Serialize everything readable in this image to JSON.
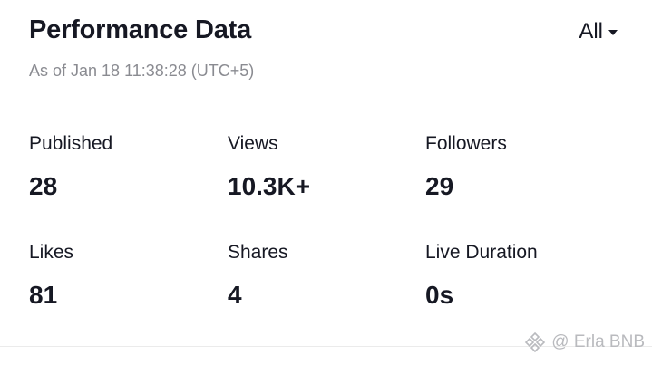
{
  "header": {
    "title": "Performance Data",
    "filter_label": "All",
    "filter_icon": "caret-down-icon",
    "subtitle": "As of Jan 18 11:38:28 (UTC+5)"
  },
  "metrics": [
    {
      "label": "Published",
      "value": "28"
    },
    {
      "label": "Views",
      "value": "10.3K+"
    },
    {
      "label": "Followers",
      "value": "29"
    },
    {
      "label": "Likes",
      "value": "81"
    },
    {
      "label": "Shares",
      "value": "4"
    },
    {
      "label": "Live Duration",
      "value": "0s"
    }
  ],
  "watermark": {
    "text": "@ Erla BNB",
    "icon": "binance-logo-icon"
  },
  "colors": {
    "text_primary": "#161823",
    "text_secondary": "#8a8b91",
    "watermark": "#b9babe"
  }
}
